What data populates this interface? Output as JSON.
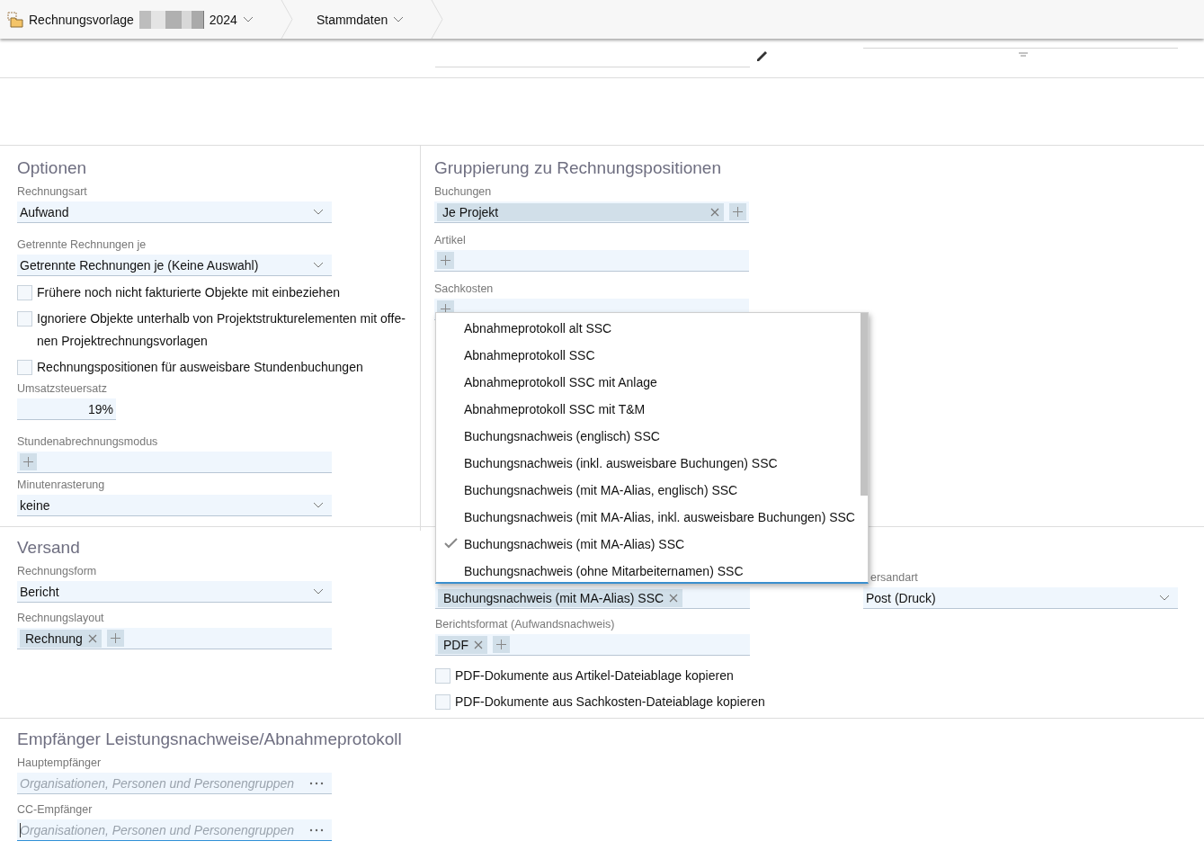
{
  "breadcrumbs": [
    {
      "kind": "record",
      "label": "Rechnungsvorlage",
      "year": "2024"
    },
    {
      "kind": "page",
      "label": "Stammdaten"
    }
  ],
  "optionen": {
    "title": "Optionen",
    "fields": [
      {
        "kind": "select",
        "label": "Rechnungsart",
        "value": "Aufwand"
      },
      {
        "kind": "select",
        "label": "Getrennte Rechnungen je",
        "value": "Getrennte Rechnungen je (Keine Auswahl)"
      },
      {
        "kind": "checkbox",
        "label": "Frühere noch nicht fakturierte Objekte mit einbeziehen",
        "checked": false
      },
      {
        "kind": "checkbox",
        "label": "Ignoriere Objekte unterhalb von Projektstrukturelementen mit offe-nen Projektrechnungsvorlagen",
        "checked": false
      },
      {
        "kind": "checkbox",
        "label": "Rechnungspositionen für ausweisbare Stundenbuchungen",
        "checked": false
      },
      {
        "kind": "number",
        "label": "Umsatzsteuersatz",
        "value": "19%"
      },
      {
        "kind": "tags",
        "label": "Stundenabrechnungsmodus"
      },
      {
        "kind": "select",
        "label": "Minutenrasterung",
        "value": "keine"
      }
    ]
  },
  "gruppierung": {
    "title": "Gruppierung zu Rechnungspositionen",
    "fields": [
      {
        "kind": "tags",
        "label": "Buchungen",
        "tags": [
          {
            "label": "Je Projekt",
            "fill": true
          }
        ]
      },
      {
        "kind": "tags",
        "label": "Artikel"
      },
      {
        "kind": "tags",
        "label": "Sachkosten"
      }
    ]
  },
  "versand": {
    "title": "Versand",
    "columns": [
      [
        {
          "kind": "select",
          "label": "Rechnungsform",
          "value": "Bericht"
        },
        {
          "kind": "tags",
          "label": "Rechnungslayout",
          "tags": [
            {
              "label": "Rechnung",
              "fill": false
            }
          ]
        }
      ],
      [
        {
          "kind": "tags",
          "tags": [
            {
              "label": "Buchungsnachweis (mit MA-Alias) SSC",
              "fill": false
            }
          ],
          "noadd": true
        },
        {
          "kind": "tags",
          "label": "Berichtsformat (Aufwandsnachweis)",
          "tags": [
            {
              "label": "PDF",
              "fill": false
            }
          ]
        },
        {
          "kind": "checkbox",
          "label": "PDF-Dokumente aus Artikel-Dateiablage kopieren",
          "checked": false
        },
        {
          "kind": "checkbox",
          "label": "PDF-Dokumente aus Sachkosten-Dateiablage kopieren",
          "checked": false
        }
      ],
      [
        {
          "kind": "select",
          "label": "ersandart",
          "value": "Post (Druck)"
        }
      ]
    ]
  },
  "empfaenger": {
    "title": "Empfänger Leistungsnachweise/Abnahmeprotokoll",
    "fields": [
      {
        "kind": "lookup",
        "label": "Hauptempfänger",
        "placeholder": "Organisationen, Personen und Personengruppen",
        "focused": false
      },
      {
        "kind": "lookup",
        "label": "CC-Empfänger",
        "placeholder": "Organisationen, Personen und Personengruppen",
        "focused": true
      }
    ]
  },
  "dropdown": {
    "items": [
      {
        "label": "Abnahmeprotokoll alt SSC",
        "checked": false
      },
      {
        "label": "Abnahmeprotokoll SSC",
        "checked": false
      },
      {
        "label": "Abnahmeprotokoll SSC mit Anlage",
        "checked": false
      },
      {
        "label": "Abnahmeprotokoll SSC mit T&M",
        "checked": false
      },
      {
        "label": "Buchungsnachweis (englisch) SSC",
        "checked": false
      },
      {
        "label": "Buchungsnachweis (inkl. ausweisbare Buchungen) SSC",
        "checked": false
      },
      {
        "label": "Buchungsnachweis (mit MA-Alias, englisch) SSC",
        "checked": false
      },
      {
        "label": "Buchungsnachweis (mit MA-Alias, inkl. ausweisbare Buchungen) SSC",
        "checked": false
      },
      {
        "label": "Buchungsnachweis (mit MA-Alias) SSC",
        "checked": true
      },
      {
        "label": "Buchungsnachweis (ohne Mitarbeiternamen) SSC",
        "checked": false
      }
    ]
  }
}
